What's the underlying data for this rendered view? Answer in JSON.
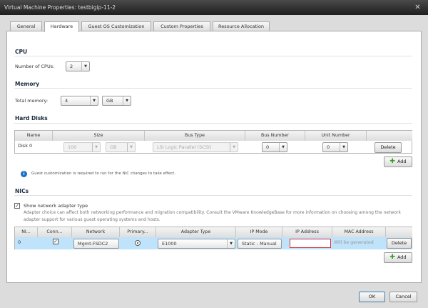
{
  "window": {
    "title": "Virtual Machine Properties: testbigip-11-2",
    "close_icon": "close-icon"
  },
  "tabs": [
    {
      "label": "General"
    },
    {
      "label": "Hardware",
      "active": true
    },
    {
      "label": "Guest OS Customization"
    },
    {
      "label": "Custom Properties"
    },
    {
      "label": "Resource Allocation"
    }
  ],
  "cpu": {
    "heading": "CPU",
    "label": "Number of CPUs:",
    "value": "2"
  },
  "memory": {
    "heading": "Memory",
    "label": "Total memory:",
    "value": "4",
    "unit": "GB"
  },
  "hard_disks": {
    "heading": "Hard Disks",
    "columns": [
      "Name",
      "Size",
      "Bus Type",
      "Bus Number",
      "Unit Number"
    ],
    "rows": [
      {
        "name": "Disk 0",
        "size": "100",
        "unit": "GB",
        "bus_type": "LSI Logic Parallel (SCSI)",
        "bus_number": "0",
        "unit_number": "0",
        "delete": "Delete"
      }
    ],
    "add": "Add"
  },
  "info": "Guest customization is required to run for the NIC changes to take effect.",
  "nics": {
    "heading": "NICs",
    "show_type_label": "Show network adapter type",
    "show_type_checked": true,
    "description": "Adapter choice can affect both networking performance and migration compatibility. Consult the VMware KnowledgeBase for more information on choosing among the network adapter support for various guest operating systems and hosts.",
    "columns": [
      "NI...",
      "Conn...",
      "Network",
      "Primary...",
      "Adapter Type",
      "IP Mode",
      "IP Address",
      "MAC Address"
    ],
    "rows": [
      {
        "index": "0",
        "connected": true,
        "network": "Mgmt-FSDC2",
        "primary": true,
        "adapter_type": "E1000",
        "ip_mode": "Static - Manual",
        "ip_address": "",
        "mac_address": "Will be generated",
        "delete": "Delete"
      }
    ],
    "add": "Add"
  },
  "footer": {
    "ok": "OK",
    "cancel": "Cancel"
  }
}
